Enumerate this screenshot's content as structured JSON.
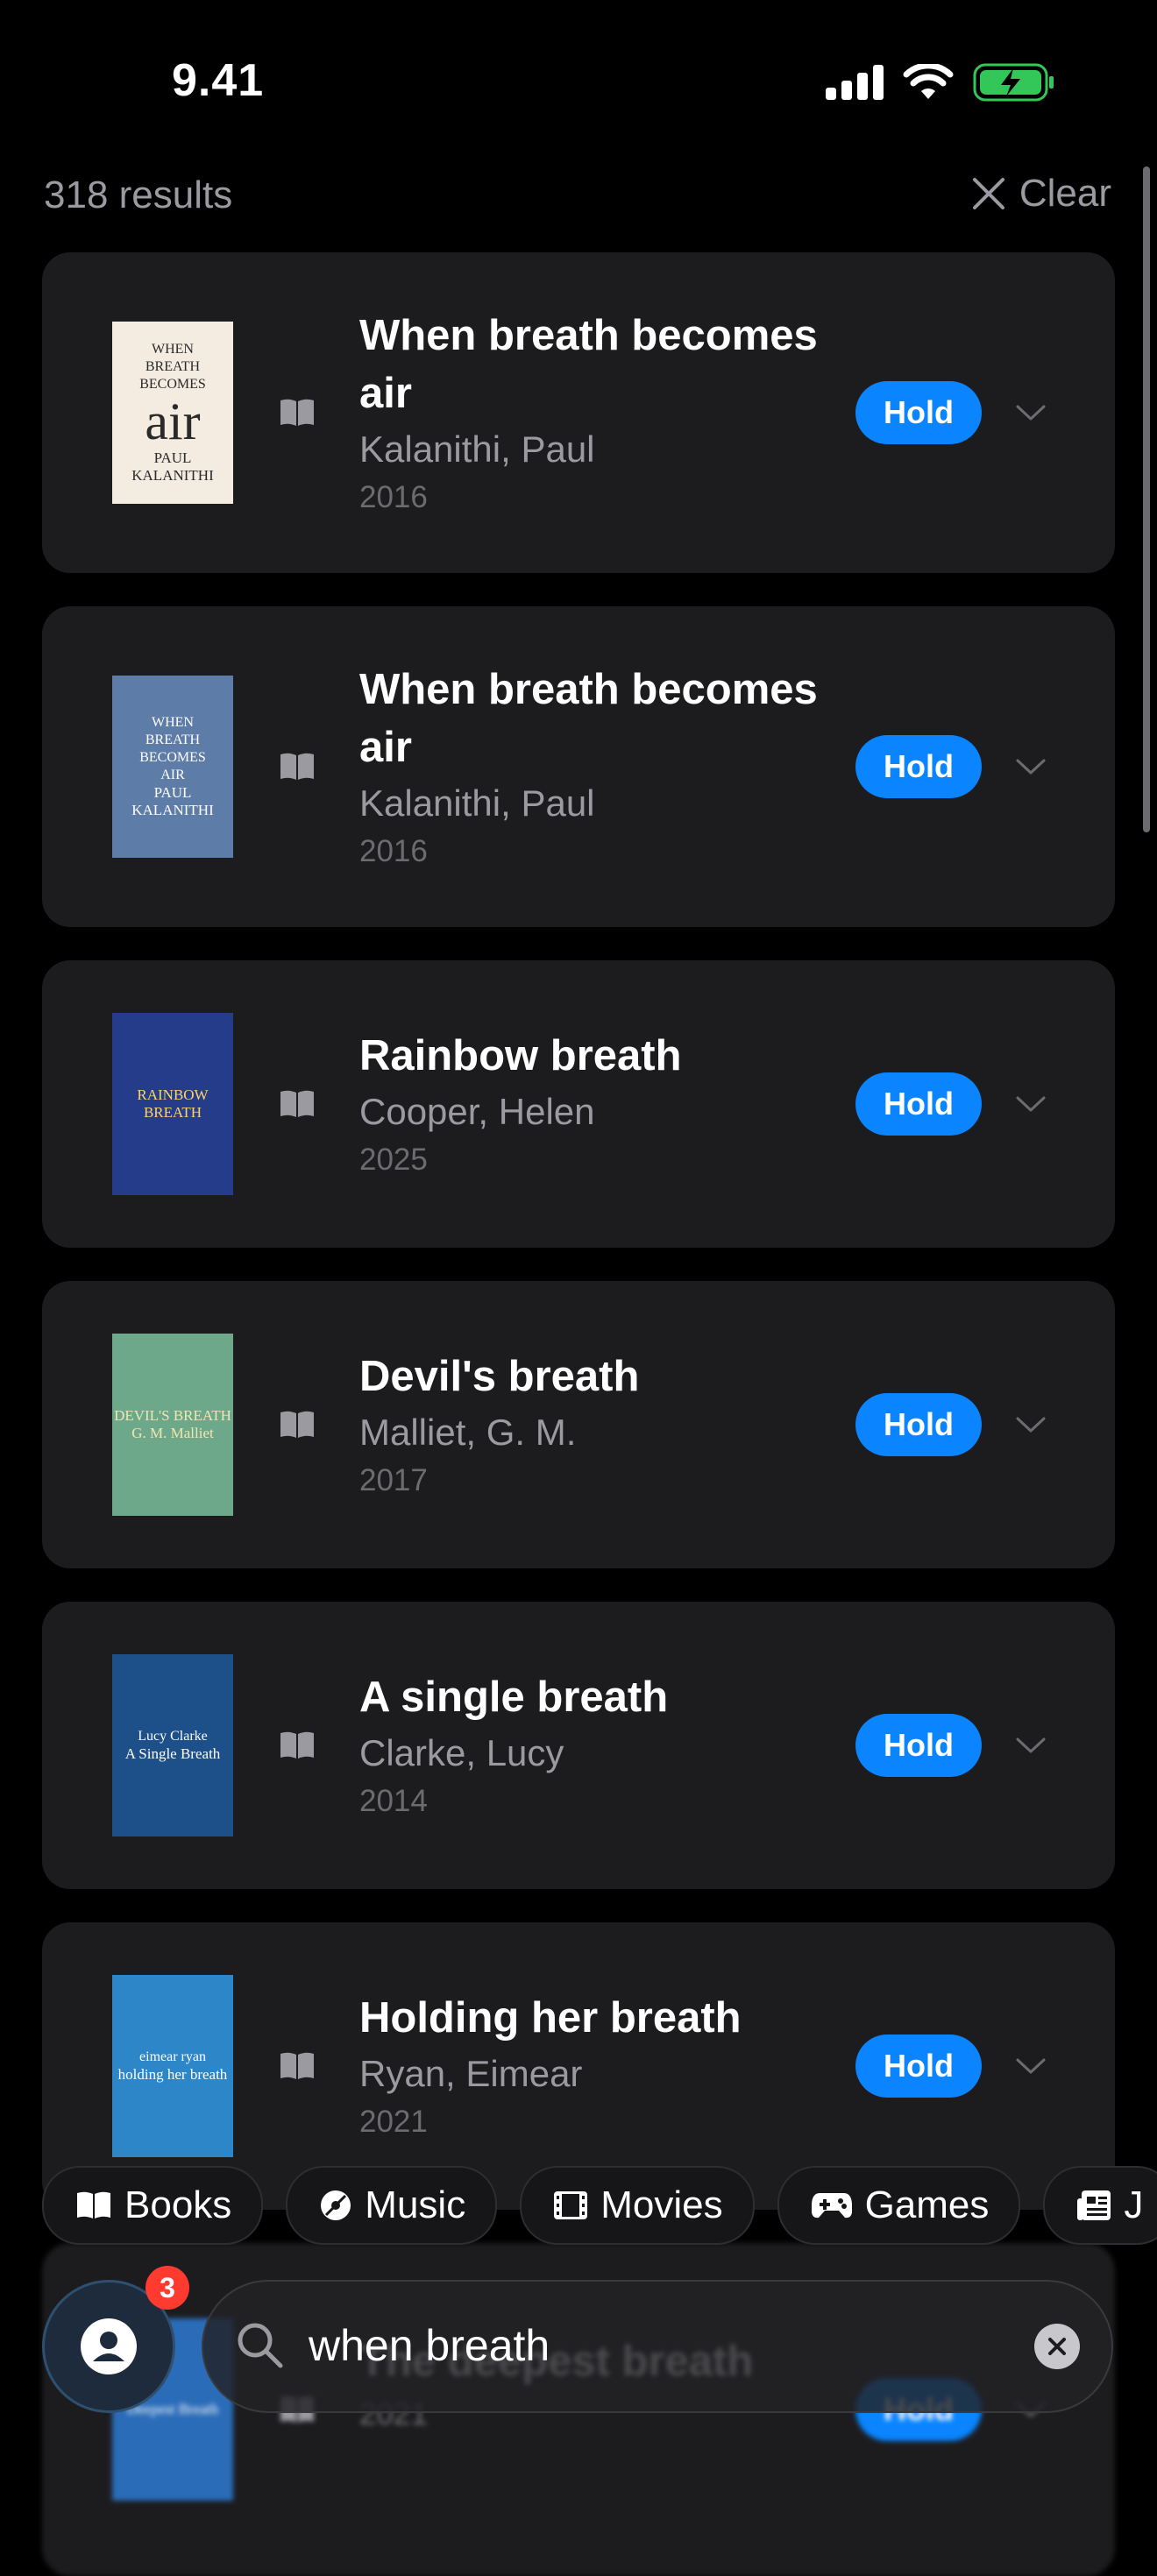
{
  "status_bar": {
    "time": "9.41"
  },
  "header": {
    "results_count": "318 results",
    "clear_label": "Clear"
  },
  "results": [
    {
      "title": "When breath becomes air",
      "author": "Kalanithi, Paul",
      "year": "2016",
      "action": "Hold",
      "cover": {
        "bg": "#f4ece0",
        "fg": "#2a2a2a",
        "lines": [
          "WHEN",
          "BREATH",
          "BECOMES",
          "air",
          "PAUL KALANITHI"
        ]
      }
    },
    {
      "title": "When breath becomes air",
      "author": "Kalanithi, Paul",
      "year": "2016",
      "action": "Hold",
      "cover": {
        "bg": "#5e7ca8",
        "fg": "#ffffff",
        "lines": [
          "WHEN",
          "BREATH",
          "BECOMES",
          "AIR",
          "PAUL KALANITHI"
        ]
      }
    },
    {
      "title": "Rainbow breath",
      "author": "Cooper, Helen",
      "year": "2025",
      "action": "Hold",
      "cover": {
        "bg": "#243c8a",
        "fg": "#ffd36a",
        "lines": [
          "RAINBOW BREATH"
        ]
      }
    },
    {
      "title": "Devil's breath",
      "author": "Malliet, G. M.",
      "year": "2017",
      "action": "Hold",
      "cover": {
        "bg": "#6ea88a",
        "fg": "#f2e6b0",
        "lines": [
          "DEVIL'S BREATH",
          "G. M. Malliet"
        ]
      }
    },
    {
      "title": "A single breath",
      "author": "Clarke, Lucy",
      "year": "2014",
      "action": "Hold",
      "cover": {
        "bg": "#1d4f88",
        "fg": "#ffffff",
        "lines": [
          "Lucy Clarke",
          "A Single Breath"
        ]
      }
    },
    {
      "title": "Holding her breath",
      "author": "Ryan, Eimear",
      "year": "2021",
      "action": "Hold",
      "cover": {
        "bg": "#2d86c8",
        "fg": "#ffffff",
        "lines": [
          "eimear ryan",
          "holding her breath"
        ]
      }
    },
    {
      "title": "The deepest breath",
      "author": "",
      "year": "2021",
      "action": "Hold",
      "cover": {
        "bg": "#2a6cb8",
        "fg": "#ffffff",
        "lines": [
          "Deepest Breath"
        ]
      }
    }
  ],
  "filters": [
    "Books",
    "Music",
    "Movies",
    "Games",
    "J"
  ],
  "bottom": {
    "badge_count": "3",
    "search_value": "when breath"
  }
}
